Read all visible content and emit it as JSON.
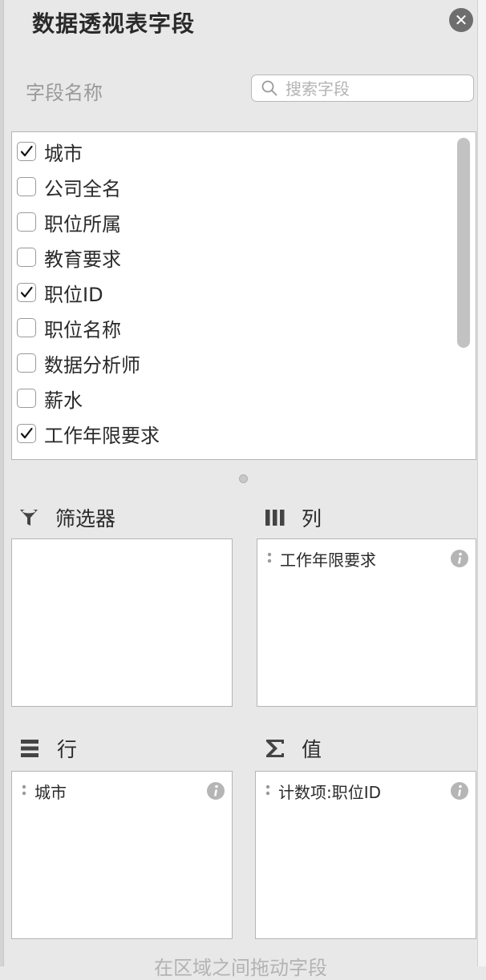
{
  "panel": {
    "title": "数据透视表字段"
  },
  "field_list": {
    "header_label": "字段名称",
    "search_placeholder": "搜索字段",
    "items": [
      {
        "label": "城市",
        "checked": true
      },
      {
        "label": "公司全名",
        "checked": false
      },
      {
        "label": "职位所属",
        "checked": false
      },
      {
        "label": "教育要求",
        "checked": false
      },
      {
        "label": "职位ID",
        "checked": true
      },
      {
        "label": "职位名称",
        "checked": false
      },
      {
        "label": "数据分析师",
        "checked": false
      },
      {
        "label": "薪水",
        "checked": false
      },
      {
        "label": "工作年限要求",
        "checked": true
      }
    ]
  },
  "areas": {
    "filter": {
      "label": "筛选器",
      "items": []
    },
    "columns": {
      "label": "列",
      "items": [
        {
          "label": "工作年限要求"
        }
      ]
    },
    "rows": {
      "label": "行",
      "items": [
        {
          "label": "城市"
        }
      ]
    },
    "values": {
      "label": "值",
      "items": [
        {
          "label": "计数项:职位ID"
        }
      ]
    }
  },
  "hint": "在区域之间拖动字段",
  "icons": {
    "close": "close-icon",
    "search": "search-icon",
    "filter": "funnel-icon",
    "columns": "columns-icon",
    "rows": "rows-icon",
    "values": "sigma-icon",
    "info": "info-icon",
    "grip": "drag-handle-icon"
  },
  "colors": {
    "panel_bg": "#e8e8e8",
    "checkbox_border": "#9a9a9a",
    "close_bg": "#6e6e6e"
  }
}
